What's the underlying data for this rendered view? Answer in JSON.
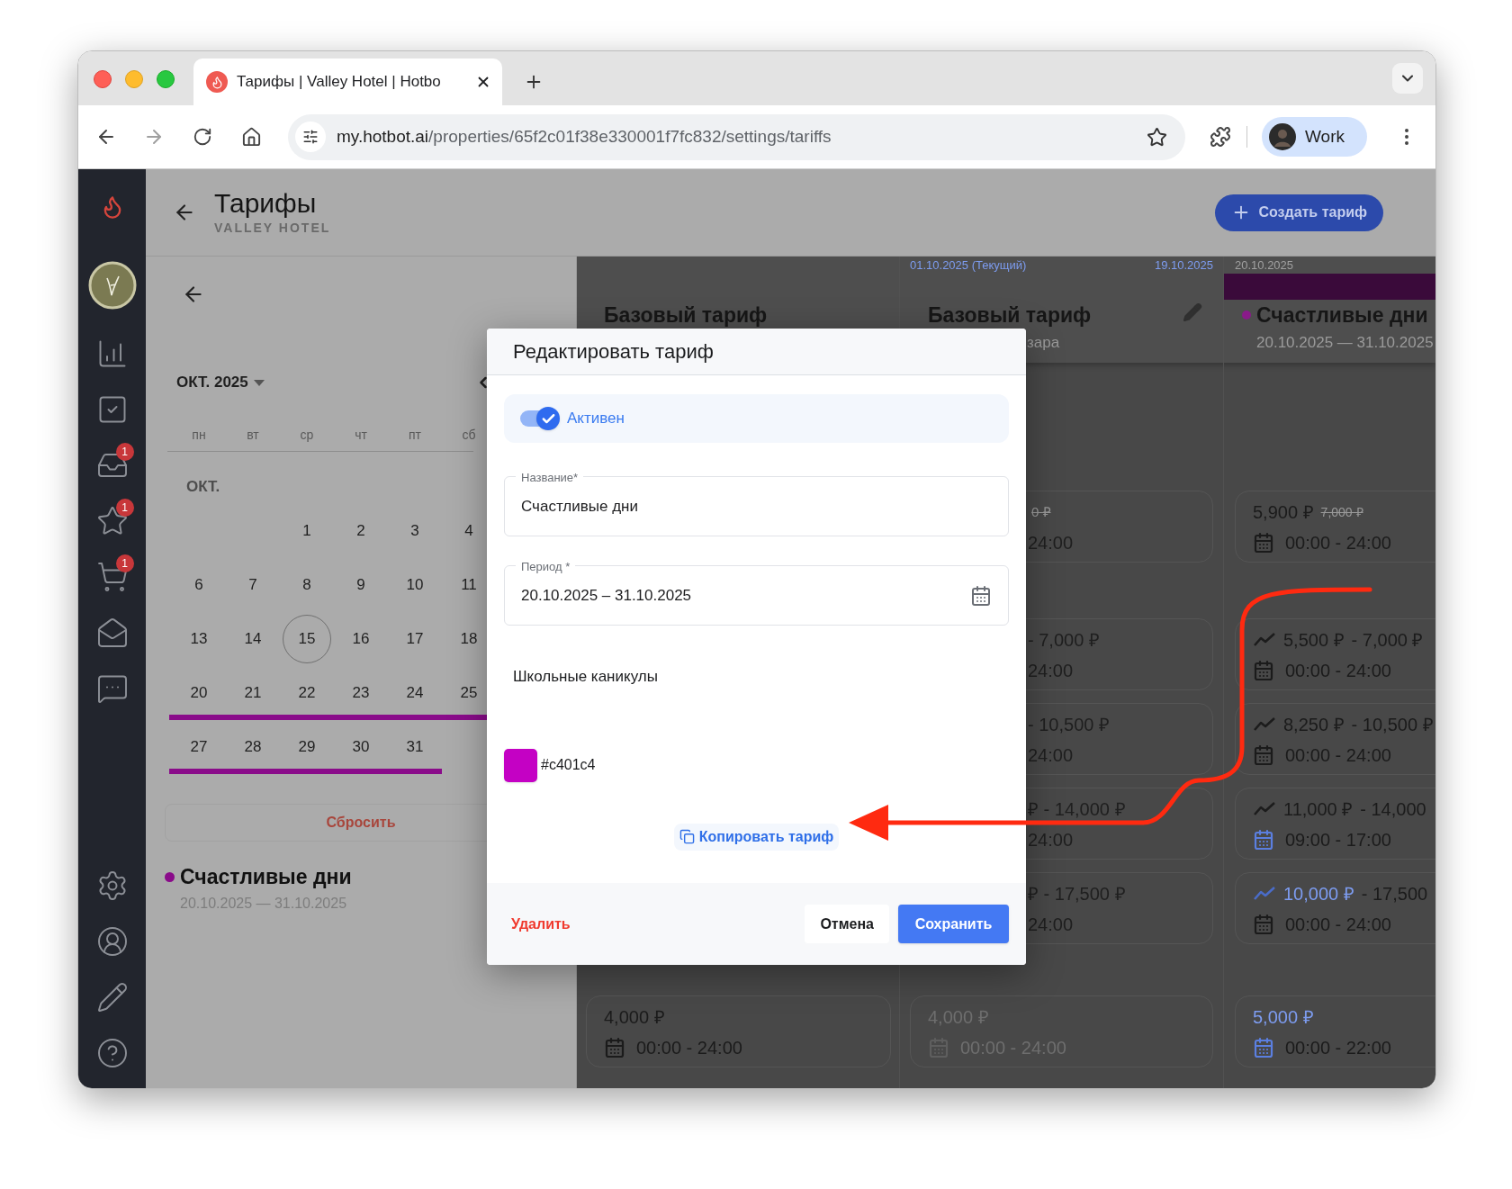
{
  "browser": {
    "tab_title": "Тарифы | Valley Hotel | Hotbo",
    "url_host": "my.hotbot.ai",
    "url_path": "/properties/65f2c01f38e330001f7fc832/settings/tariffs",
    "profile": "Work"
  },
  "sidebar": {
    "badges": [
      "1",
      "1",
      "1"
    ]
  },
  "header": {
    "title": "Тарифы",
    "subtitle": "VALLEY HOTEL",
    "create_button": "Создать тариф"
  },
  "calendar": {
    "month_label": "ОКТ. 2025",
    "weekdays": [
      "пн",
      "вт",
      "ср",
      "чт",
      "пт",
      "сб"
    ],
    "section_label": "ОКТ.",
    "weeks": [
      {
        "days": [
          {
            "label": "1",
            "today": false
          },
          {
            "label": "2",
            "today": false
          },
          {
            "label": "3",
            "today": false
          },
          {
            "label": "4",
            "today": false
          }
        ],
        "in_range": false
      },
      {
        "days": [
          {
            "label": "6",
            "today": false
          },
          {
            "label": "7",
            "today": false
          },
          {
            "label": "8",
            "today": false
          },
          {
            "label": "9",
            "today": false
          },
          {
            "label": "10",
            "today": false
          },
          {
            "label": "11",
            "today": false
          }
        ],
        "in_range": false
      },
      {
        "days": [
          {
            "label": "13",
            "today": false
          },
          {
            "label": "14",
            "today": false
          },
          {
            "label": "15",
            "today": true
          },
          {
            "label": "16",
            "today": false
          },
          {
            "label": "17",
            "today": false
          },
          {
            "label": "18",
            "today": false
          }
        ],
        "in_range": false
      },
      {
        "days": [
          {
            "label": "20",
            "today": false
          },
          {
            "label": "21",
            "today": false
          },
          {
            "label": "22",
            "today": false
          },
          {
            "label": "23",
            "today": false
          },
          {
            "label": "24",
            "today": false
          },
          {
            "label": "25",
            "today": false
          }
        ],
        "in_range": true
      },
      {
        "days": [
          {
            "label": "27",
            "today": false
          },
          {
            "label": "28",
            "today": false
          },
          {
            "label": "29",
            "today": false
          },
          {
            "label": "30",
            "today": false
          },
          {
            "label": "31",
            "today": false
          }
        ],
        "in_range": true
      }
    ],
    "reset_button": "Сбросить",
    "legend": {
      "name": "Счастливые дни",
      "dates": "20.10.2025 — 31.10.2025",
      "color": "#8a0b8a"
    }
  },
  "grid": {
    "period_labels": [
      {
        "text": "01.10.2025 (Текущий)",
        "current": true
      },
      {
        "text": "19.10.2025",
        "current": true
      },
      {
        "text": "20.10.2025",
        "current": false
      }
    ],
    "columns": [
      {
        "title": "Базовый тариф",
        "editable": false
      },
      {
        "title": "Базовый тариф",
        "subtitle": "зара",
        "editable": true
      },
      {
        "title": "Счастливые дни",
        "subtitle": "20.10.2025 — 31.10.2025",
        "color": "#8a1a8a",
        "editable": false
      }
    ],
    "rows": [
      {
        "cells": [
          {
            "kind": "hidden"
          },
          {
            "kind": "partial",
            "price": "0 ₽",
            "struck": true,
            "time": "24:00"
          },
          {
            "kind": "full",
            "price": "5,900 ₽",
            "old_price": "7,000 ₽",
            "time": "00:00 - 24:00",
            "trend": false,
            "price_highlight": false,
            "calendar_highlight": false,
            "muted": false
          }
        ]
      },
      {
        "cells": [
          {
            "kind": "hidden"
          },
          {
            "kind": "partial",
            "price": "- 7,000 ₽",
            "struck": false,
            "time": "24:00"
          },
          {
            "kind": "full",
            "price": "5,500 ₽",
            "price_to": "- 7,000 ₽",
            "time": "00:00 - 24:00",
            "trend": true,
            "price_highlight": false,
            "calendar_highlight": false,
            "muted": false
          }
        ]
      },
      {
        "cells": [
          {
            "kind": "hidden"
          },
          {
            "kind": "partial",
            "price": "- 10,500 ₽",
            "struck": false,
            "time": "24:00"
          },
          {
            "kind": "full",
            "price": "8,250 ₽",
            "price_to": "- 10,500 ₽",
            "time": "00:00 - 24:00",
            "trend": true,
            "price_highlight": false,
            "calendar_highlight": false,
            "muted": false
          }
        ]
      },
      {
        "cells": [
          {
            "kind": "hidden"
          },
          {
            "kind": "partial",
            "price": "₽ - 14,000 ₽",
            "struck": false,
            "time": "24:00"
          },
          {
            "kind": "full",
            "price": "11,000 ₽",
            "price_to": "- 14,000",
            "time": "09:00 - 17:00",
            "trend": true,
            "price_highlight": false,
            "calendar_highlight": true,
            "muted": false
          }
        ]
      },
      {
        "cells": [
          {
            "kind": "hidden"
          },
          {
            "kind": "partial",
            "price": "₽ - 17,500 ₽",
            "struck": false,
            "time": "24:00"
          },
          {
            "kind": "full",
            "price": "10,000 ₽",
            "price_to": "- 17,500",
            "time": "00:00 - 24:00",
            "trend": true,
            "price_highlight": true,
            "calendar_highlight": false,
            "muted": false
          }
        ]
      },
      {
        "cells": [
          {
            "kind": "full",
            "price": "4,000 ₽",
            "time": "00:00 - 24:00",
            "trend": false,
            "price_highlight": false,
            "calendar_highlight": false,
            "muted": false
          },
          {
            "kind": "full",
            "price": "4,000 ₽",
            "time": "00:00 - 24:00",
            "trend": false,
            "price_highlight": false,
            "calendar_highlight": false,
            "muted": true
          },
          {
            "kind": "full",
            "price": "5,000 ₽",
            "time": "00:00 - 22:00",
            "trend": false,
            "price_highlight": true,
            "calendar_highlight": true,
            "muted": false
          }
        ]
      }
    ]
  },
  "modal": {
    "title": "Редактировать тариф",
    "active_toggle": {
      "label": "Активен",
      "on": true
    },
    "name_field": {
      "label": "Название*",
      "value": "Счастливые дни"
    },
    "period_field": {
      "label": "Период *",
      "value": "20.10.2025 – 31.10.2025"
    },
    "holiday_label": "Школьные каникулы",
    "color": "#c401c4",
    "copy_button": "Копировать тариф",
    "delete_button": "Удалить",
    "cancel_button": "Отмена",
    "save_button": "Сохранить"
  }
}
